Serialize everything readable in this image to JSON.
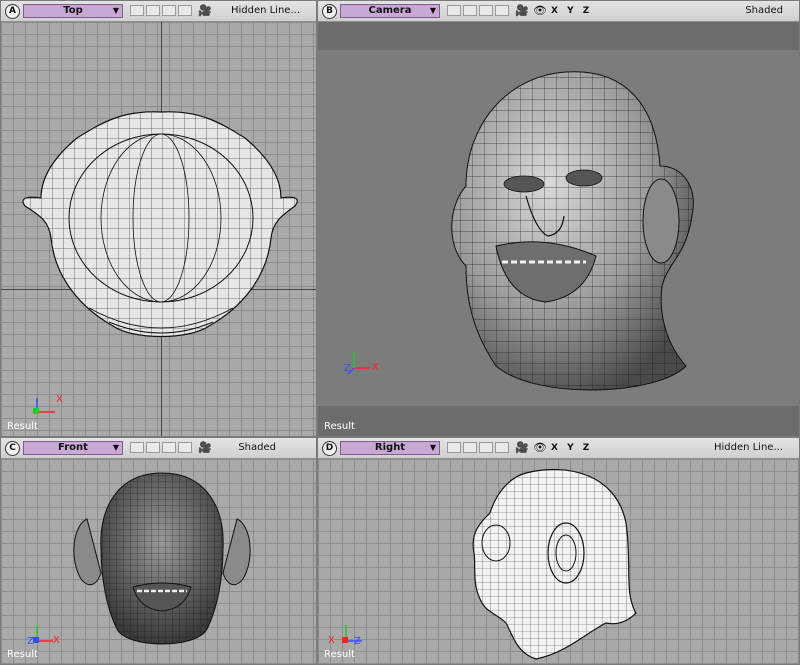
{
  "viewports": {
    "a": {
      "letter": "A",
      "name": "Top",
      "mode": "Hidden Line...",
      "result": "Result"
    },
    "b": {
      "letter": "B",
      "name": "Camera",
      "mode": "Shaded",
      "result": "Result",
      "xyz": "X Y Z"
    },
    "c": {
      "letter": "C",
      "name": "Front",
      "mode": "Shaded",
      "result": "Result"
    },
    "d": {
      "letter": "D",
      "name": "Right",
      "mode": "Hidden Line...",
      "result": "Result",
      "xyz": "X Y Z"
    }
  },
  "gizmo": {
    "x_label": "X",
    "y_label": "Y",
    "z_label": "Z"
  },
  "icons": {
    "camera": "camera-icon",
    "eye": "eye-icon",
    "dropdown": "triangle-down-icon"
  },
  "colors": {
    "dropdown": "#c9a8d6",
    "grid": "#a9a9a9",
    "camera_bg": "#7c7c7c",
    "axis_x": "#ff2020",
    "axis_y": "#20d020",
    "axis_z": "#3050ff"
  }
}
